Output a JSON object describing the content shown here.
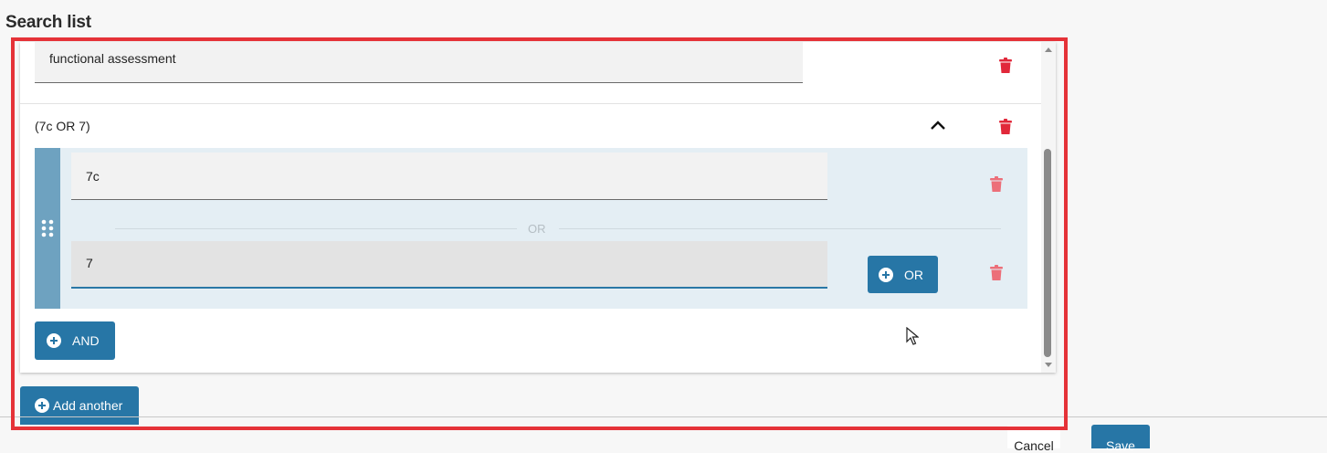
{
  "page": {
    "title": "Search list"
  },
  "search_items": {
    "first_term": {
      "value": "functional assessment"
    },
    "group": {
      "label": "(7c OR 7)",
      "terms": [
        {
          "value": "7c"
        },
        {
          "value": "7"
        }
      ],
      "separator": "OR",
      "or_button": "OR"
    },
    "and_button": "AND"
  },
  "add_another_button": "Add another",
  "footer": {
    "cancel_label": "Cancel",
    "save_label": "Save"
  },
  "colors": {
    "primary": "#2776a6",
    "delete": "#e1283a",
    "highlight": "#e53238",
    "group_background": "#e4eef4",
    "drag_handle": "#6ea2c0"
  },
  "icons": [
    "trash-icon",
    "chevron-up-icon",
    "drag-handle-icon",
    "plus-circle-icon"
  ]
}
